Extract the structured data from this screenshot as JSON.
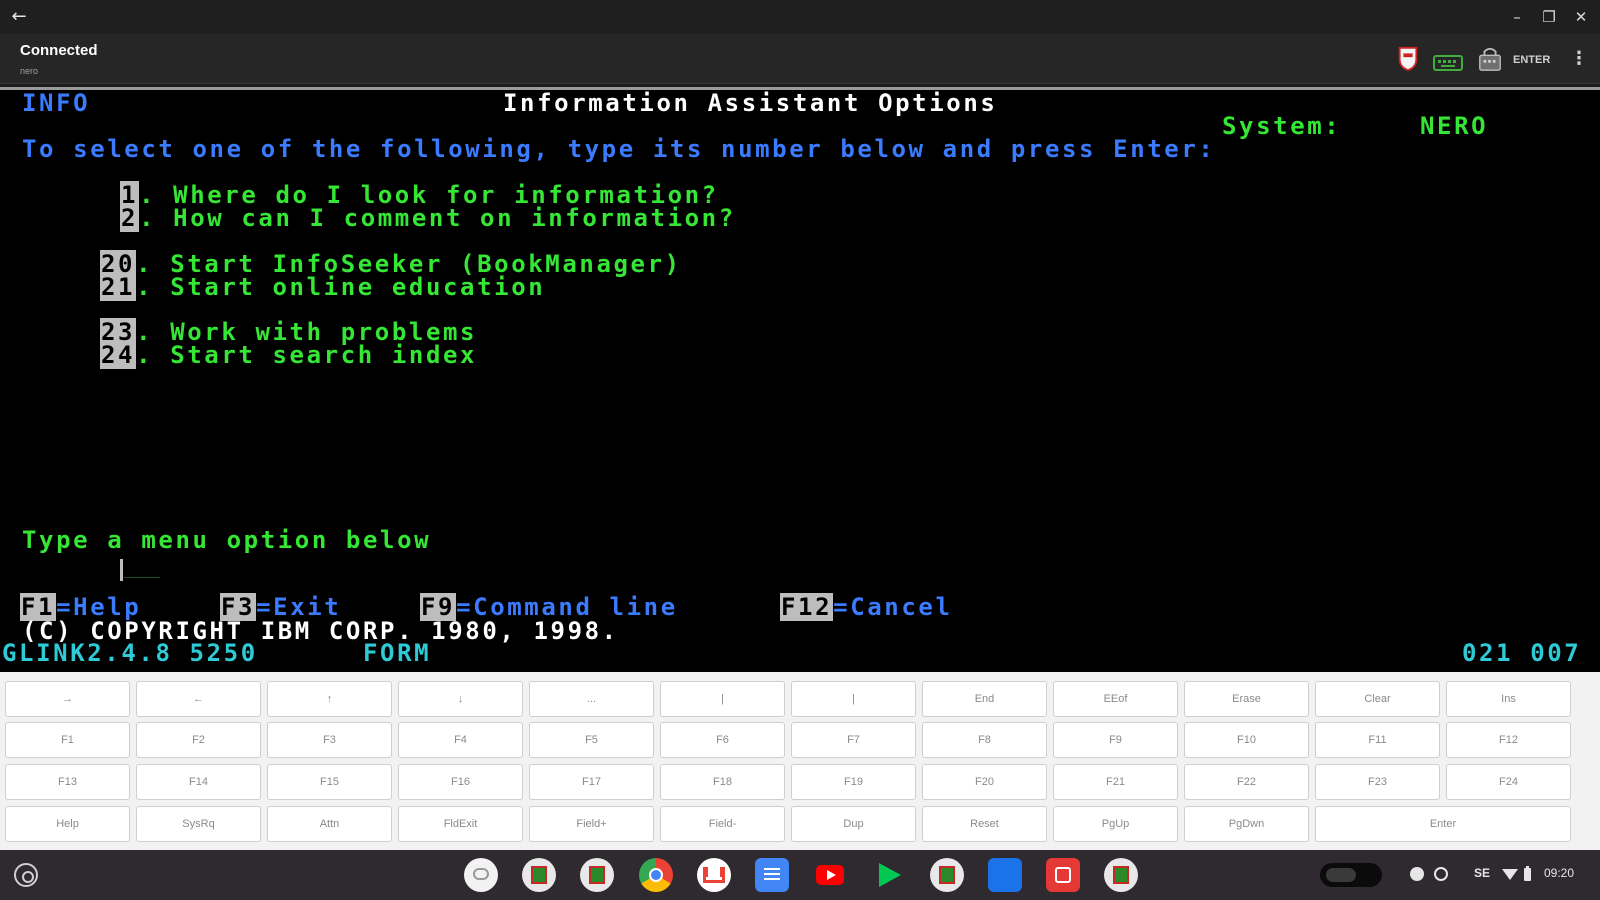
{
  "window": {
    "back_icon": "arrow-left-icon"
  },
  "status": {
    "connection": "Connected",
    "host": "nero",
    "enter_label": "ENTER"
  },
  "terminal": {
    "header_left": "INFO",
    "title": "Information Assistant Options",
    "system_label": "System:",
    "system_value": "NERO",
    "instruction": "To select one of the following, type its number below and press Enter:",
    "options": [
      {
        "num": "1",
        "text": ". Where do I look for information?"
      },
      {
        "num": "2",
        "text": ". How can I comment on information?"
      },
      {
        "num": "20",
        "text": ". Start InfoSeeker (BookManager)"
      },
      {
        "num": "21",
        "text": ". Start online education"
      },
      {
        "num": "23",
        "text": ". Work with problems"
      },
      {
        "num": "24",
        "text": ". Start search index"
      }
    ],
    "prompt": "Type a menu option below",
    "fkeys": [
      {
        "key": "F1",
        "label": "=Help"
      },
      {
        "key": "F3",
        "label": "=Exit"
      },
      {
        "key": "F9",
        "label": "=Command line"
      },
      {
        "key": "F12",
        "label": "=Cancel"
      }
    ],
    "copyright": "(C) COPYRIGHT IBM CORP. 1980, 1998.",
    "status_left": "GLINK2.4.8 5250",
    "status_mode": "FORM",
    "status_pos": "021 007"
  },
  "keyboard": {
    "row1": [
      "→",
      "←",
      "↑",
      "↓",
      "...",
      "|",
      "|",
      "End",
      "EEof",
      "Erase",
      "Clear",
      "Ins"
    ],
    "row2": [
      "F1",
      "F2",
      "F3",
      "F4",
      "F5",
      "F6",
      "F7",
      "F8",
      "F9",
      "F10",
      "F11",
      "F12"
    ],
    "row3": [
      "F13",
      "F14",
      "F15",
      "F16",
      "F17",
      "F18",
      "F19",
      "F20",
      "F21",
      "F22",
      "F23",
      "F24"
    ],
    "row4": [
      "Help",
      "SysRq",
      "Attn",
      "FldExit",
      "Field+",
      "Field-",
      "Dup",
      "Reset",
      "PgUp",
      "PgDwn",
      "Enter"
    ]
  },
  "shelf": {
    "apps": [
      "chat-icon",
      "glink-icon",
      "glink-icon",
      "chrome-icon",
      "gmail-icon",
      "docs-icon",
      "youtube-icon",
      "play-store-icon",
      "glink-icon",
      "files-icon",
      "calendar-icon",
      "glink-icon"
    ],
    "lang": "SE",
    "time": "09:20"
  },
  "colors": {
    "terminal_bg": "#000000",
    "green": "#35e635",
    "blue": "#3b7bff",
    "cyan": "#2ecbd6"
  }
}
